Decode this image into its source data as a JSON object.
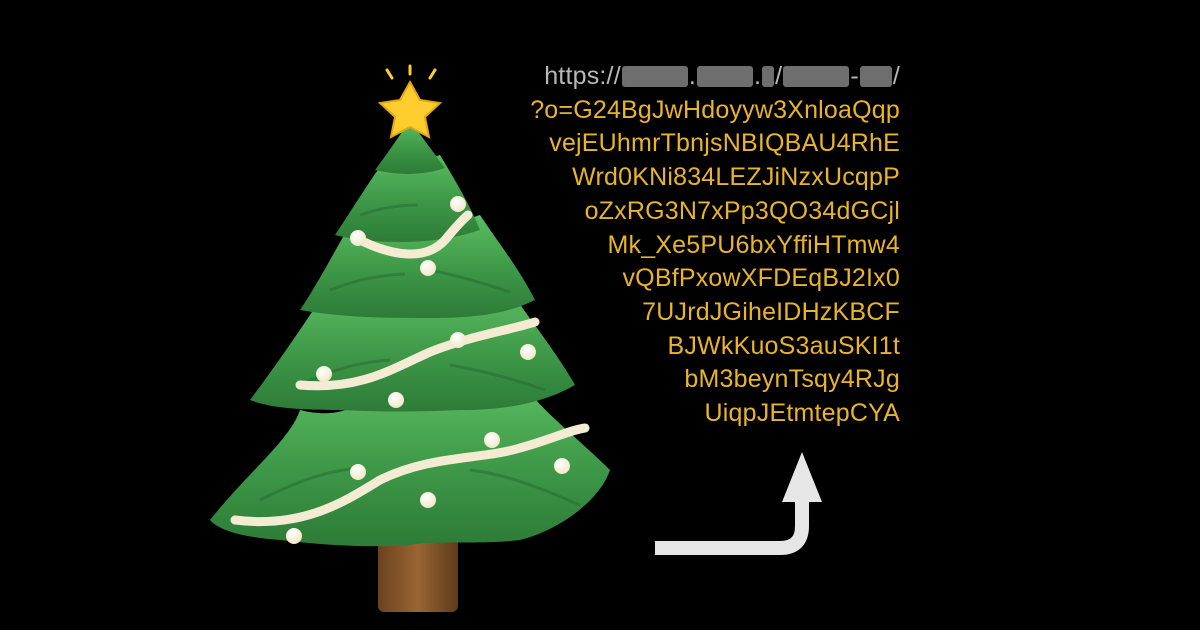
{
  "url": {
    "scheme": "https://",
    "host_sep_1": ".",
    "host_sep_2": ".",
    "path_sep_1": "/",
    "path_hyphen": "-",
    "path_sep_2": "/",
    "query_lines": [
      "?o=G24BgJwHdoyyw3XnloaQqp",
      "vejEUhmrTbnjsNBIQBAU4RhE",
      "Wrd0KNi834LEZJiNzxUcqpP",
      "oZxRG3N7xPp3QO34dGCjl",
      "Mk_Xe5PU6bxYffiHTmw4",
      "vQBfPxowXFDEqBJ2Ix0",
      "7UJrdJGiheIDHzKBCF",
      "BJWkKuoS3auSKI1t",
      "bM3beynTsqy4RJg",
      "UiqpJEtmtepCYA"
    ]
  },
  "colors": {
    "background": "#000000",
    "url_prefix": "#b8b8b8",
    "redaction": "#6e6e6e",
    "query_text": "#e9b42a",
    "arrow": "#e6e6e6",
    "tree_dark": "#2f7a3a",
    "tree_light": "#4caf55",
    "garland": "#f3ecd2",
    "star": "#ffcd2e",
    "trunk": "#8a5a2b"
  },
  "icons": [
    "christmas-tree-icon",
    "star-icon",
    "curved-arrow-up-icon"
  ]
}
